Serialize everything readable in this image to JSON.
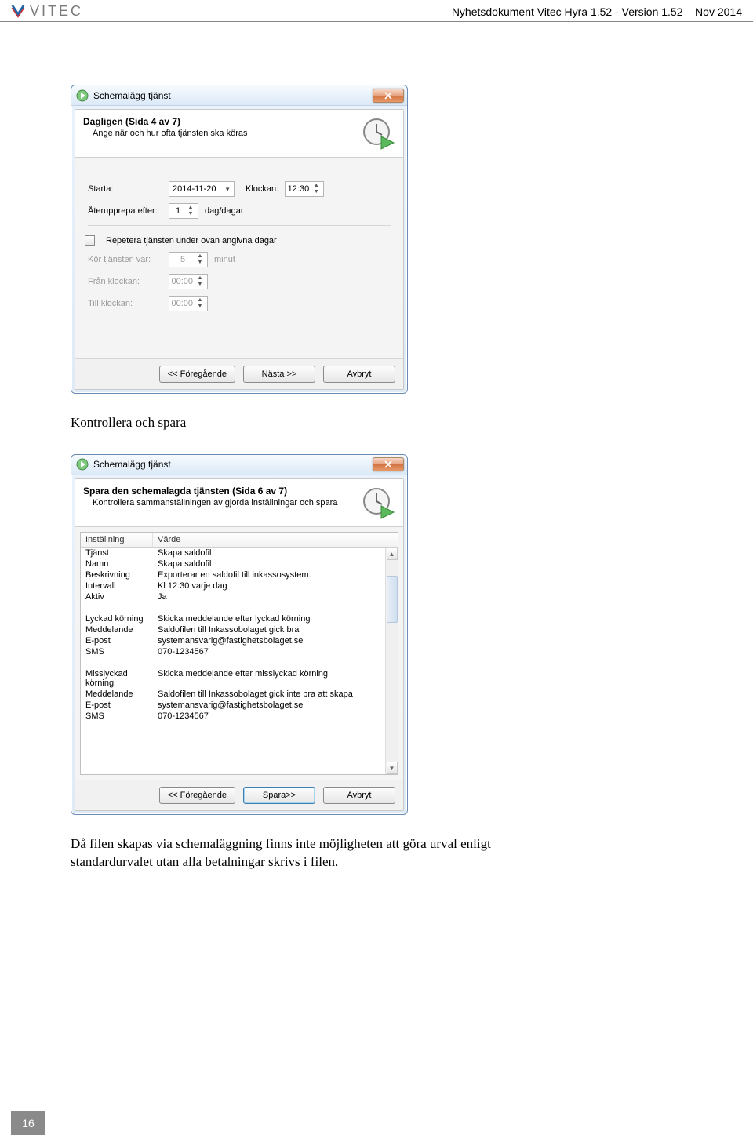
{
  "header": {
    "brand": "VITEC",
    "doc_title": "Nyhetsdokument Vitec Hyra 1.52 - Version 1.52 – Nov 2014"
  },
  "page_number": "16",
  "dialog1": {
    "window_title": "Schemalägg tjänst",
    "wizard_title": "Dagligen (Sida 4 av 7)",
    "wizard_subtitle": "Ange när och hur ofta tjänsten ska köras",
    "starta_label": "Starta:",
    "starta_value": "2014-11-20",
    "klockan_label": "Klockan:",
    "klockan_value": "12:30",
    "aterupprepa_label": "Återupprepa efter:",
    "aterupprepa_value": "1",
    "aterupprepa_unit": "dag/dagar",
    "repetera_label": "Repetera tjänsten under ovan angivna dagar",
    "kor_label": "Kör tjänsten var:",
    "kor_value": "5",
    "kor_unit": "minut",
    "fran_label": "Från klockan:",
    "fran_value": "00:00",
    "till_label": "Till klockan:",
    "till_value": "00:00",
    "btn_prev": "<< Föregående",
    "btn_next": "Nästa >>",
    "btn_cancel": "Avbryt"
  },
  "mid_text": "Kontrollera och spara",
  "dialog2": {
    "window_title": "Schemalägg tjänst",
    "wizard_title": "Spara den schemalagda tjänsten (Sida 6 av 7)",
    "wizard_subtitle": "Kontrollera sammanställningen av gjorda inställningar och spara",
    "col1": "Inställning",
    "col2": "Värde",
    "rows": [
      {
        "k": "Tjänst",
        "v": "Skapa saldofil"
      },
      {
        "k": "Namn",
        "v": "Skapa saldofil"
      },
      {
        "k": "Beskrivning",
        "v": "Exporterar en saldofil till inkassosystem."
      },
      {
        "k": "Intervall",
        "v": "Kl 12:30 varje dag"
      },
      {
        "k": "Aktiv",
        "v": "Ja"
      },
      {
        "k": "",
        "v": ""
      },
      {
        "k": "Lyckad körning",
        "v": "Skicka meddelande efter lyckad körning"
      },
      {
        "k": "Meddelande",
        "v": "Saldofilen till Inkassobolaget gick bra"
      },
      {
        "k": "E-post",
        "v": "systemansvarig@fastighetsbolaget.se"
      },
      {
        "k": "SMS",
        "v": "070-1234567"
      },
      {
        "k": "",
        "v": ""
      },
      {
        "k": "Misslyckad körning",
        "v": "Skicka meddelande efter misslyckad körning"
      },
      {
        "k": "Meddelande",
        "v": "Saldofilen till Inkassobolaget gick inte bra att skapa"
      },
      {
        "k": "E-post",
        "v": "systemansvarig@fastighetsbolaget.se"
      },
      {
        "k": "SMS",
        "v": "070-1234567"
      }
    ],
    "btn_prev": "<< Föregående",
    "btn_save": "Spara>>",
    "btn_cancel": "Avbryt"
  },
  "bottom_text": "Då filen skapas via schemaläggning finns inte möjligheten att göra urval enligt standardurvalet utan alla betalningar skrivs i filen."
}
